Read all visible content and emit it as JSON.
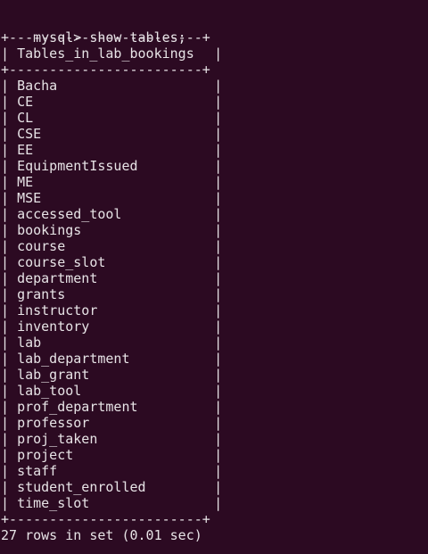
{
  "terminal": {
    "prompt": "mysql>",
    "command": " show tables;",
    "separator": "+------------------------+",
    "header": {
      "left": "| ",
      "label": "Tables_in_lab_bookings",
      "right": " |"
    },
    "rows": [
      "Bacha",
      "CE",
      "CL",
      "CSE",
      "EE",
      "EquipmentIssued",
      "ME",
      "MSE",
      "accessed_tool",
      "bookings",
      "course",
      "course_slot",
      "department",
      "grants",
      "instructor",
      "inventory",
      "lab",
      "lab_department",
      "lab_grant",
      "lab_tool",
      "prof_department",
      "professor",
      "proj_taken",
      "project",
      "staff",
      "student_enrolled",
      "time_slot"
    ],
    "row_border_left": "| ",
    "row_border_right": " |",
    "summary": "27 rows in set (0.01 sec)"
  },
  "colors": {
    "background": "#2c0a22",
    "text": "#e7e3e6"
  }
}
